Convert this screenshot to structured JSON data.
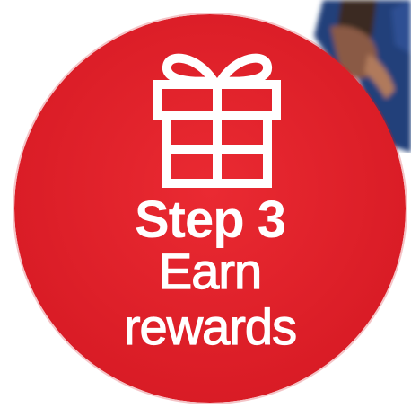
{
  "badge": {
    "step_label": "Step 3",
    "line1": "Earn",
    "line2": "rewards",
    "icon": "gift-icon",
    "background_color": "#e3212b",
    "text_color": "#ffffff"
  }
}
